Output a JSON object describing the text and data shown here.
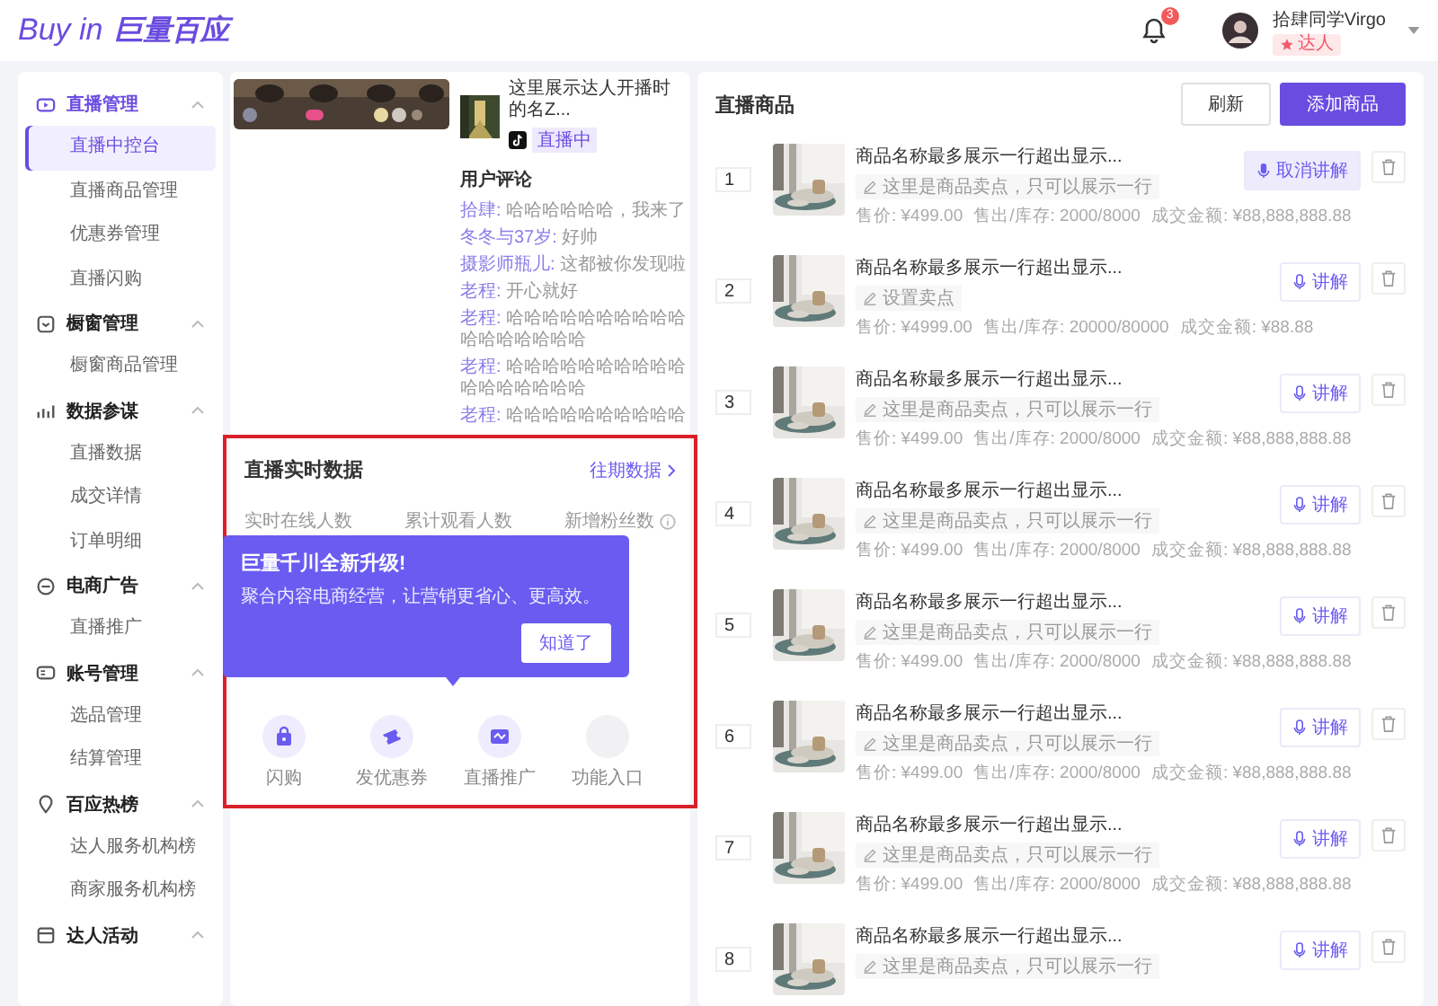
{
  "header": {
    "logo_text": "Buy in",
    "logo_brand": "巨量百应",
    "notification_count": "3",
    "user": {
      "name": "拾肆同学Virgo",
      "badge": "达人"
    }
  },
  "sidebar": {
    "groups": [
      {
        "label": "直播管理",
        "expanded": true,
        "items": [
          {
            "label": "直播中控台",
            "selected": true
          },
          {
            "label": "直播商品管理",
            "selected": false
          },
          {
            "label": "优惠券管理",
            "selected": false
          },
          {
            "label": "直播闪购",
            "selected": false
          }
        ]
      },
      {
        "label": "橱窗管理",
        "expanded": true,
        "items": [
          {
            "label": "橱窗商品管理",
            "selected": false
          }
        ]
      },
      {
        "label": "数据参谋",
        "expanded": true,
        "items": [
          {
            "label": "直播数据",
            "selected": false
          },
          {
            "label": "成交详情",
            "selected": false
          },
          {
            "label": "订单明细",
            "selected": false
          }
        ]
      },
      {
        "label": "电商广告",
        "expanded": true,
        "items": [
          {
            "label": "直播推广",
            "selected": false
          }
        ]
      },
      {
        "label": "账号管理",
        "expanded": true,
        "items": [
          {
            "label": "选品管理",
            "selected": false
          },
          {
            "label": "结算管理",
            "selected": false
          }
        ]
      },
      {
        "label": "百应热榜",
        "expanded": true,
        "items": [
          {
            "label": "达人服务机构榜",
            "selected": false
          },
          {
            "label": "商家服务机构榜",
            "selected": false
          }
        ]
      },
      {
        "label": "达人活动",
        "expanded": true
      }
    ]
  },
  "stream": {
    "kind": "picture",
    "title": "这里展示达人开播时的名Z...",
    "status": "直播中"
  },
  "comments": {
    "title": "用户评论",
    "items": [
      {
        "user": "拾肆:",
        "text": "哈哈哈哈哈哈，我来了"
      },
      {
        "user": "冬冬与37岁:",
        "text": "好帅"
      },
      {
        "user": "摄影师瓶儿:",
        "text": "这都被你发现啦"
      },
      {
        "user": "老程:",
        "text": "开心就好"
      },
      {
        "user": "老程:",
        "text": "哈哈哈哈哈哈哈哈哈哈哈哈哈哈哈哈哈"
      },
      {
        "user": "老程:",
        "text": "哈哈哈哈哈哈哈哈哈哈哈哈哈哈哈哈哈"
      },
      {
        "user": "老程:",
        "text": "哈哈哈哈哈哈哈哈哈哈"
      }
    ]
  },
  "realtime": {
    "title": "直播实时数据",
    "link": "往期数据",
    "highlighted": true,
    "metrics": [
      {
        "label": "实时在线人数",
        "info": false
      },
      {
        "label": "累计观看人数",
        "info": false
      },
      {
        "label": "新增粉丝数",
        "info": true
      }
    ],
    "popover": {
      "title": "巨量千川全新升级!",
      "text": "聚合内容电商经营，让营销更省心、更高效。",
      "button": "知道了"
    },
    "tools": [
      {
        "label": "闪购",
        "kind": "bag"
      },
      {
        "label": "发优惠券",
        "kind": "ticket"
      },
      {
        "label": "直播推广",
        "kind": "promo"
      },
      {
        "label": "功能入口",
        "kind": "empty"
      }
    ]
  },
  "products": {
    "title": "直播商品",
    "refresh": "刷新",
    "add": "添加商品",
    "items": [
      {
        "rank": "1",
        "name": "商品名称最多展示一行超出显示...",
        "selling_point": "这里是商品卖点，只可以展示一行",
        "price": "售价: ¥499.00",
        "stock": "售出/库存: 2000/8000",
        "amount": "成交金额: ¥88,888,888.88",
        "action": "取消讲解",
        "explaining": true
      },
      {
        "rank": "2",
        "name": "商品名称最多展示一行超出显示...",
        "selling_point": "设置卖点",
        "price": "售价: ¥4999.00",
        "stock": "售出/库存: 20000/80000",
        "amount": "成交金额: ¥88.88",
        "action": "讲解",
        "explaining": false
      },
      {
        "rank": "3",
        "name": "商品名称最多展示一行超出显示...",
        "selling_point": "这里是商品卖点，只可以展示一行",
        "price": "售价: ¥499.00",
        "stock": "售出/库存: 2000/8000",
        "amount": "成交金额: ¥88,888,888.88",
        "action": "讲解",
        "explaining": false
      },
      {
        "rank": "4",
        "name": "商品名称最多展示一行超出显示...",
        "selling_point": "这里是商品卖点，只可以展示一行",
        "price": "售价: ¥499.00",
        "stock": "售出/库存: 2000/8000",
        "amount": "成交金额: ¥88,888,888.88",
        "action": "讲解",
        "explaining": false
      },
      {
        "rank": "5",
        "name": "商品名称最多展示一行超出显示...",
        "selling_point": "这里是商品卖点，只可以展示一行",
        "price": "售价: ¥499.00",
        "stock": "售出/库存: 2000/8000",
        "amount": "成交金额: ¥88,888,888.88",
        "action": "讲解",
        "explaining": false
      },
      {
        "rank": "6",
        "name": "商品名称最多展示一行超出显示...",
        "selling_point": "这里是商品卖点，只可以展示一行",
        "price": "售价: ¥499.00",
        "stock": "售出/库存: 2000/8000",
        "amount": "成交金额: ¥88,888,888.88",
        "action": "讲解",
        "explaining": false
      },
      {
        "rank": "7",
        "name": "商品名称最多展示一行超出显示...",
        "selling_point": "这里是商品卖点，只可以展示一行",
        "price": "售价: ¥499.00",
        "stock": "售出/库存: 2000/8000",
        "amount": "成交金额: ¥88,888,888.88",
        "action": "讲解",
        "explaining": false
      },
      {
        "rank": "8",
        "name": "商品名称最多展示一行超出显示...",
        "selling_point": "这里是商品卖点，只可以展示一行",
        "action": "讲解",
        "explaining": false
      }
    ]
  }
}
